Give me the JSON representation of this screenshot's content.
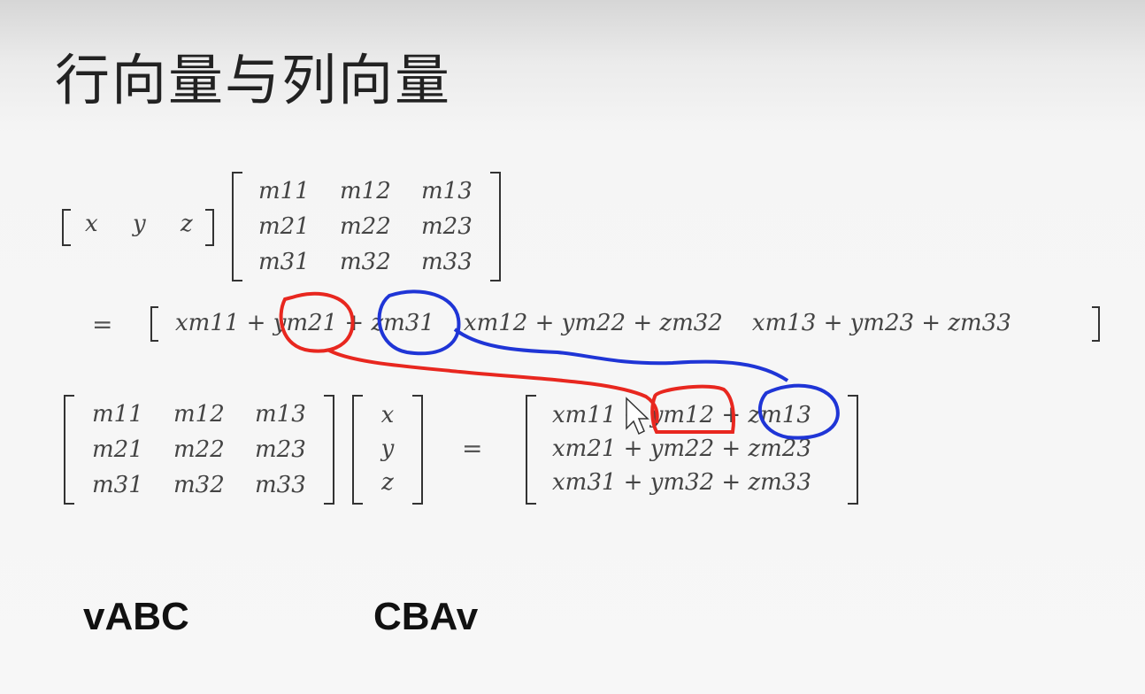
{
  "title": "行向量与列向量",
  "row_form": {
    "vector": [
      "x",
      "y",
      "z"
    ],
    "matrix": [
      [
        "m11",
        "m12",
        "m13"
      ],
      [
        "m21",
        "m22",
        "m23"
      ],
      [
        "m31",
        "m32",
        "m33"
      ]
    ],
    "equals": "=",
    "result": "xm11 + ym21 + zm31    xm12 + ym22 + zm32    xm13 + ym23 + zm33"
  },
  "column_form": {
    "matrix": [
      [
        "m11",
        "m12",
        "m13"
      ],
      [
        "m21",
        "m22",
        "m23"
      ],
      [
        "m31",
        "m32",
        "m33"
      ]
    ],
    "vector": [
      "x",
      "y",
      "z"
    ],
    "equals": "=",
    "result_rows": [
      "xm11 + ym12 + zm13",
      "xm21 + ym22 + zm23",
      "xm31 + ym32 + zm33"
    ]
  },
  "labels": {
    "left": "vABC",
    "right": "CBAv"
  },
  "annotation_colors": {
    "red": "#e8271f",
    "blue": "#1f35d6"
  }
}
